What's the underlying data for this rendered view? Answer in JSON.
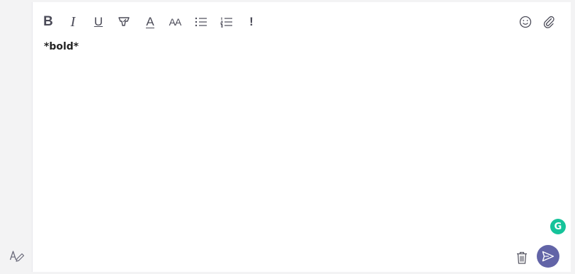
{
  "toolbar": {
    "bold_glyph": "B",
    "italic_glyph": "I",
    "underline_glyph": "U",
    "font_color_glyph": "A",
    "font_size_glyph": "AA",
    "important_glyph": "!"
  },
  "editor": {
    "content": "*bold*"
  },
  "grammarly": {
    "glyph": "G",
    "color": "#15c39a"
  },
  "colors": {
    "send_button": "#6264a7",
    "icon": "#4a4a57",
    "background": "#f3f3f4"
  }
}
